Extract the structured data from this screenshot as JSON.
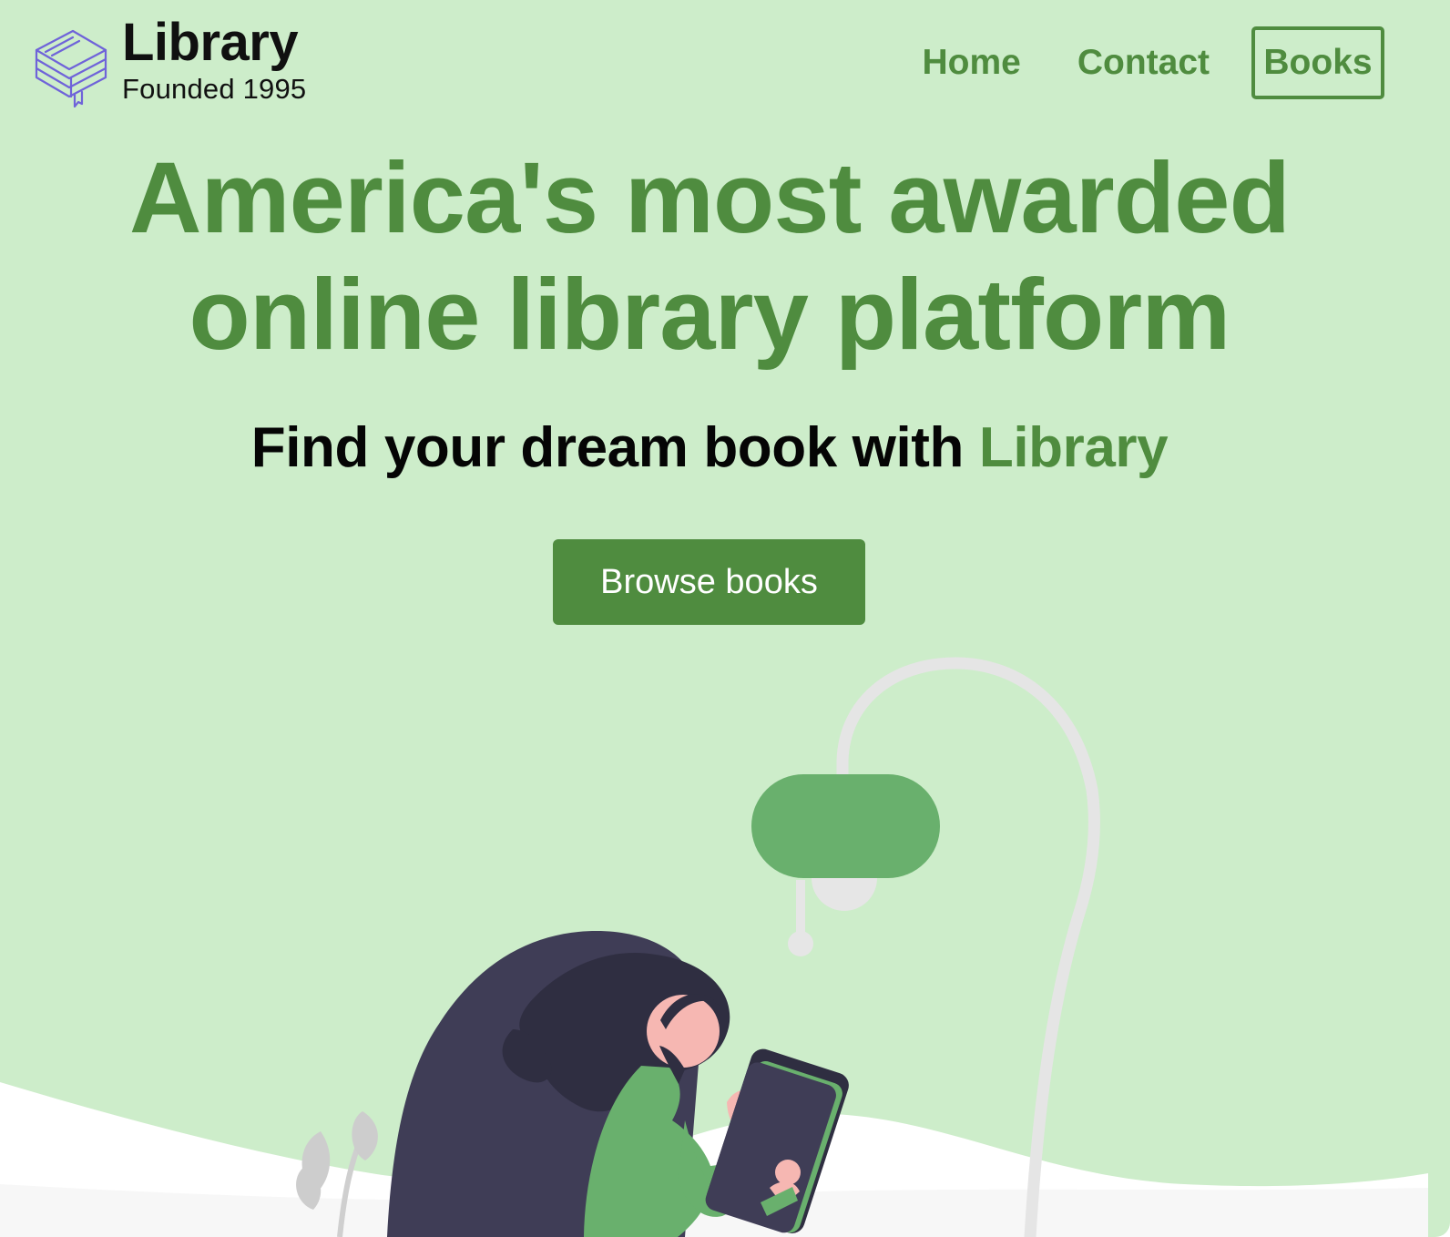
{
  "brand": {
    "name": "Library",
    "tagline": "Founded 1995",
    "icon": "books-stack-icon",
    "icon_color": "#6f63d9"
  },
  "nav": {
    "items": [
      {
        "label": "Home",
        "icon": null
      },
      {
        "label": "Contact",
        "icon": null
      },
      {
        "label": "Books",
        "icon": null
      }
    ]
  },
  "hero": {
    "title_line1": "America's most awarded",
    "title_line2": "online library platform",
    "subtitle_prefix": "Find your dream book with",
    "subtitle_accent": "Library",
    "cta_label": "Browse books"
  },
  "colors": {
    "background": "#cdedca",
    "accent": "#4f8c3f",
    "accent_light": "#69b06d",
    "dark": "#3f3d56",
    "white": "#ffffff"
  }
}
